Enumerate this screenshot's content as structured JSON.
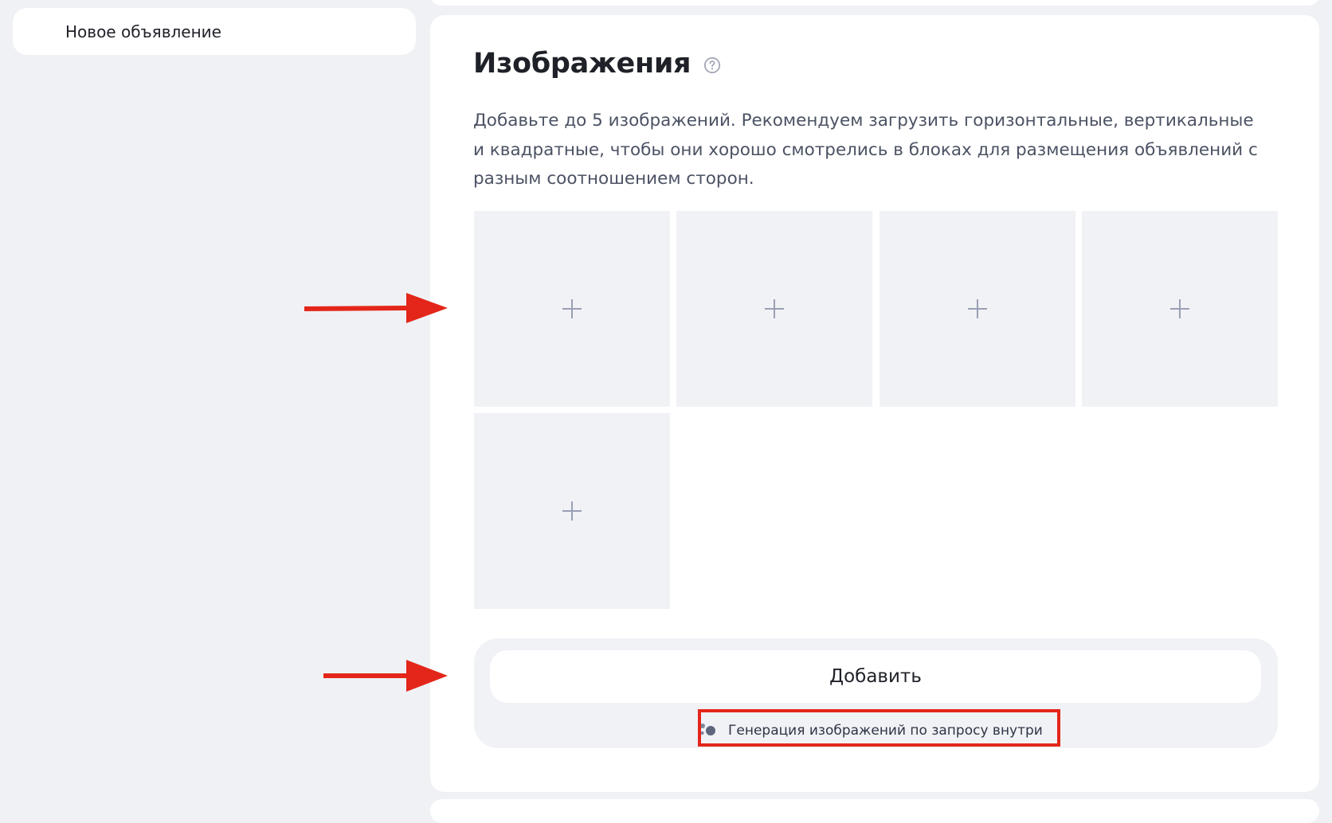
{
  "sidebar": {
    "items": [
      {
        "label": "Новое объявление"
      }
    ]
  },
  "images_section": {
    "title": "Изображения",
    "help_icon": "question-circle-icon",
    "description": "Добавьте до 5 изображений. Рекомендуем загрузить горизонтальные, вертикальные и квадратные, чтобы они хорошо смотрелись в блоках для размещения объявлений с разным соотношением сторон.",
    "slots": [
      {
        "icon": "plus-icon"
      },
      {
        "icon": "plus-icon"
      },
      {
        "icon": "plus-icon"
      },
      {
        "icon": "plus-icon"
      },
      {
        "icon": "plus-icon"
      }
    ],
    "add_label": "Добавить",
    "generation": {
      "icon": "ai-dots-icon",
      "label": "Генерация изображений по запросу внутри"
    }
  },
  "annotations": {
    "arrow_color": "#e32619",
    "highlight_color": "#e32619"
  },
  "colors": {
    "page_background": "#f0f1f5",
    "card_background": "#ffffff",
    "slot_background": "#f1f2f6",
    "plus_color": "#9aa0b4"
  }
}
